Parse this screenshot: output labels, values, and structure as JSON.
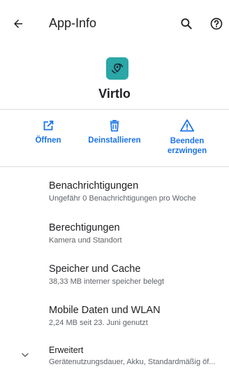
{
  "topbar": {
    "title": "App-Info",
    "back_icon": "arrow-left-icon",
    "search_icon": "search-icon",
    "help_icon": "help-circle-icon"
  },
  "app": {
    "name": "Virtlo",
    "icon": "app-location-icon",
    "icon_color": "#2aa7a6"
  },
  "actions": [
    {
      "label": "Öffnen",
      "icon": "open-external-icon"
    },
    {
      "label": "Deinstallieren",
      "icon": "trash-icon"
    },
    {
      "label": "Beenden erzwingen",
      "icon": "warning-icon"
    }
  ],
  "items": [
    {
      "title": "Benachrichtigungen",
      "subtitle": "Ungefähr 0 Benachrichtigungen pro Woche"
    },
    {
      "title": "Berechtigungen",
      "subtitle": "Kamera und Standort"
    },
    {
      "title": "Speicher und Cache",
      "subtitle": "38,33 MB interner speicher belegt"
    },
    {
      "title": "Mobile Daten und WLAN",
      "subtitle": "2,24 MB seit 23. Juni genutzt"
    },
    {
      "title": "Erweitert",
      "subtitle": "Gerätenutzungsdauer, Akku, Standardmäßig öf..."
    }
  ],
  "colors": {
    "accent": "#1a73e8",
    "text_primary": "#202124",
    "text_secondary": "#5f6368",
    "divider": "#dadce0"
  }
}
